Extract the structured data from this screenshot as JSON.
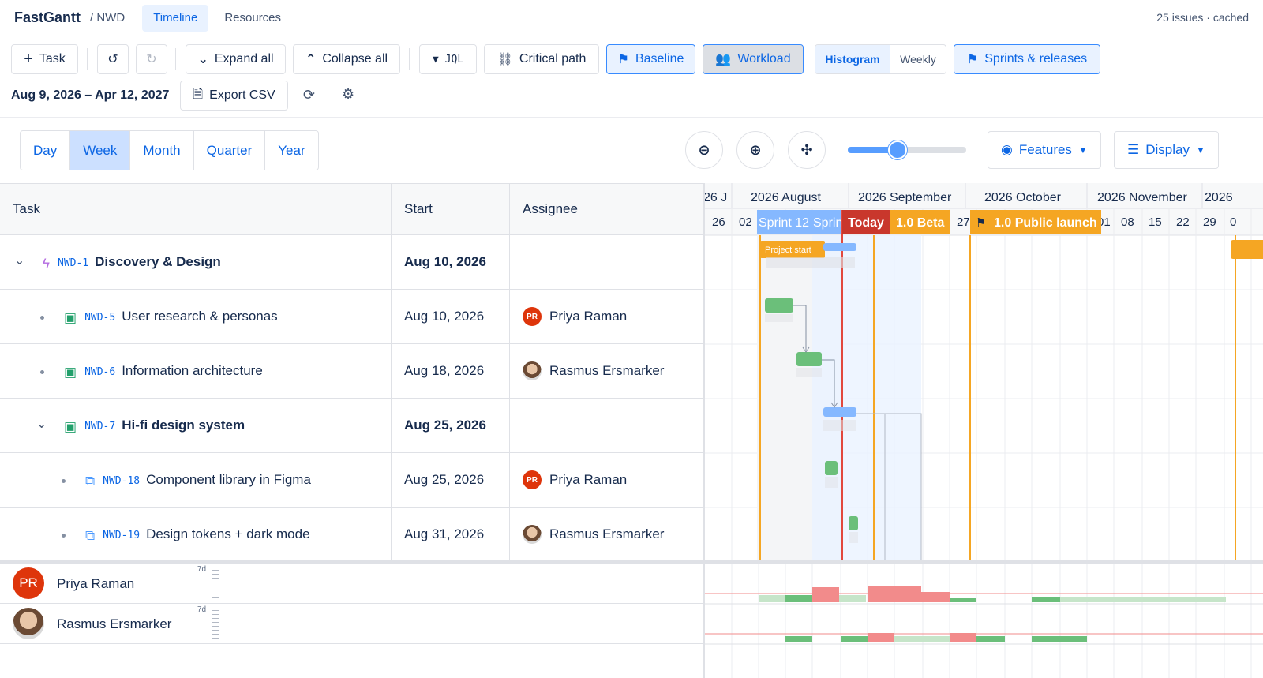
{
  "nav": {
    "brand": "FastGantt",
    "project": "/ NWD",
    "tabs": [
      {
        "label": "Timeline"
      },
      {
        "label": "Resources"
      }
    ],
    "status": "25 issues · cached"
  },
  "toolbar": {
    "task": "Task",
    "expand_all": "Expand all",
    "collapse_all": "Collapse all",
    "jql": "JQL",
    "critical_path": "Critical path",
    "baseline": "Baseline",
    "workload": "Workload",
    "histogram": "Histogram",
    "weekly": "Weekly",
    "sprints": "Sprints & releases",
    "date_range": "Aug 9, 2026 – Apr 12, 2027",
    "export_csv": "Export CSV"
  },
  "scale": {
    "options": [
      "Day",
      "Week",
      "Month",
      "Quarter",
      "Year"
    ],
    "selected": "Week"
  },
  "zoom": {
    "level": 0.42
  },
  "features": "Features",
  "display": "Display",
  "grid": {
    "columns": {
      "task": "Task",
      "start": "Start",
      "assignee": "Assignee"
    },
    "rows": [
      {
        "key": "NWD-1",
        "title": "Discovery & Design",
        "start": "Aug 10, 2026",
        "assignee": "",
        "type": "epic"
      },
      {
        "key": "NWD-5",
        "title": "User research & personas",
        "start": "Aug 10, 2026",
        "assignee": "Priya Raman",
        "type": "story"
      },
      {
        "key": "NWD-6",
        "title": "Information architecture",
        "start": "Aug 18, 2026",
        "assignee": "Rasmus Ersmarker",
        "type": "story"
      },
      {
        "key": "NWD-7",
        "title": "Hi-fi design system",
        "start": "Aug 25, 2026",
        "assignee": "",
        "type": "story"
      },
      {
        "key": "NWD-18",
        "title": "Component library in Figma",
        "start": "Aug 25, 2026",
        "assignee": "Priya Raman",
        "type": "subtask"
      },
      {
        "key": "NWD-19",
        "title": "Design tokens + dark mode",
        "start": "Aug 31, 2026",
        "assignee": "Rasmus Ersmarker",
        "type": "subtask"
      }
    ]
  },
  "timeline": {
    "months": [
      "26 J",
      "2026 August",
      "2026 September",
      "2026 October",
      "2026 November",
      "2026"
    ],
    "weeks": [
      "26",
      "02",
      "27",
      "01",
      "08",
      "15",
      "22",
      "29",
      "0"
    ],
    "markers": {
      "sprint12": "Sprint 12",
      "sprint_next": "Sprin",
      "today": "Today",
      "beta": "1.0 Beta",
      "launch": "1.0 Public launch",
      "project_start": "Project start"
    }
  },
  "resources": [
    {
      "name": "Priya Raman",
      "initials": "PR",
      "capacity": "7d"
    },
    {
      "name": "Rasmus Ersmarker",
      "initials": "",
      "capacity": "7d"
    }
  ],
  "initials_pr": "PR",
  "colors": {
    "accent": "#0c66e4",
    "today": "#e2483d",
    "release": "#f5a623",
    "bar": "#6bbf7a",
    "over": "#f28b8b"
  }
}
